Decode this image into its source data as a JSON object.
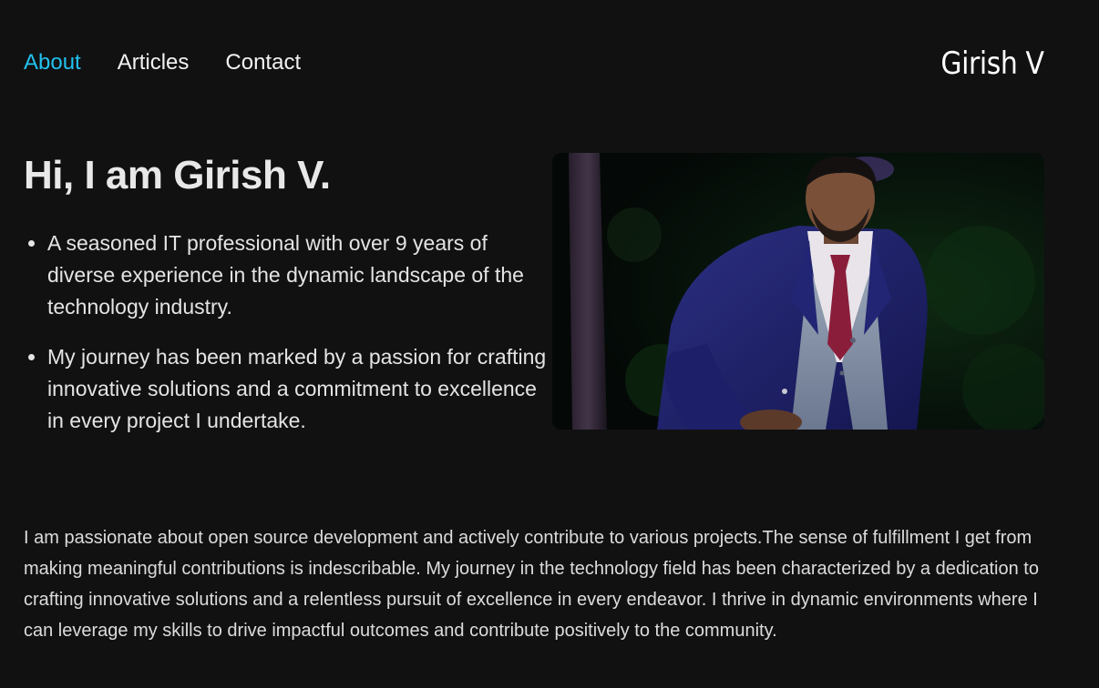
{
  "nav": {
    "items": [
      {
        "label": "About",
        "active": true
      },
      {
        "label": "Articles",
        "active": false
      },
      {
        "label": "Contact",
        "active": false
      }
    ],
    "brand": "Girish V"
  },
  "hero": {
    "heading": "Hi, I am Girish V.",
    "bullets": [
      "A seasoned IT professional with over 9 years of diverse experience in the dynamic landscape of the technology industry.",
      "My journey has been marked by a passion for crafting innovative solutions and a commitment to excellence in every project I undertake."
    ]
  },
  "bio": "I am passionate about open source development and actively contribute to various projects.The sense of fulfillment I get from making meaningful contributions is indescribable. My journey in the technology field has been characterized by a dedication to crafting innovative solutions and a relentless pursuit of excellence in every endeavor. I thrive in dynamic environments where I can leverage my skills to drive impactful outcomes and contribute positively to the community.",
  "colors": {
    "background": "#111112",
    "accent": "#22c1ee",
    "text": "#e6e6e6"
  }
}
